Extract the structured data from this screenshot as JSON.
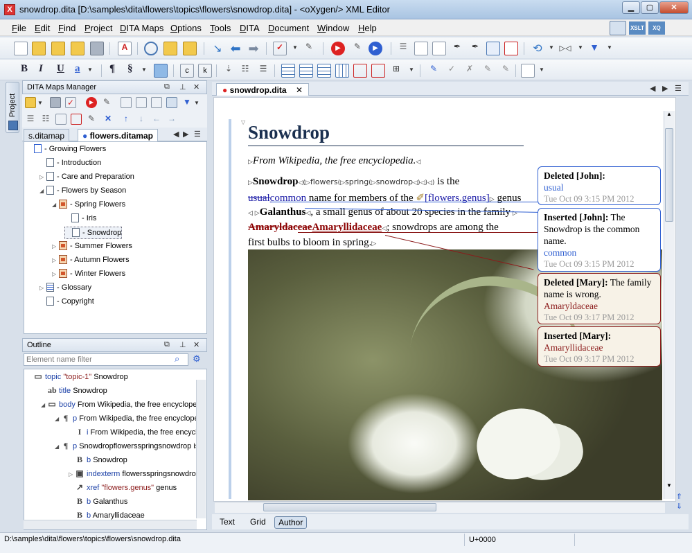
{
  "window": {
    "title": "snowdrop.dita [D:\\samples\\dita\\flowers\\topics\\flowers\\snowdrop.dita] - <oXygen/> XML Editor"
  },
  "menu": [
    "File",
    "Edit",
    "Find",
    "Project",
    "DITA Maps",
    "Options",
    "Tools",
    "DITA",
    "Document",
    "Window",
    "Help"
  ],
  "side_tab": "Project",
  "maps_manager": {
    "title": "DITA Maps Manager",
    "tabs": [
      "s.ditamap",
      "flowers.ditamap"
    ],
    "tree": [
      {
        "label": "Growing Flowers",
        "depth": 0,
        "type": "root"
      },
      {
        "label": "Introduction",
        "depth": 1,
        "type": "doc"
      },
      {
        "label": "Care and Preparation",
        "depth": 1,
        "type": "doc",
        "toggle": "▷"
      },
      {
        "label": "Flowers by Season",
        "depth": 1,
        "type": "doc",
        "toggle": "◢"
      },
      {
        "label": "Spring Flowers",
        "depth": 2,
        "type": "map",
        "toggle": "◢"
      },
      {
        "label": "Iris",
        "depth": 3,
        "type": "doc"
      },
      {
        "label": "Snowdrop",
        "depth": 3,
        "type": "doc",
        "selected": true
      },
      {
        "label": "Summer Flowers",
        "depth": 2,
        "type": "map",
        "toggle": "▷"
      },
      {
        "label": "Autumn Flowers",
        "depth": 2,
        "type": "map",
        "toggle": "▷"
      },
      {
        "label": "Winter Flowers",
        "depth": 2,
        "type": "map",
        "toggle": "▷"
      },
      {
        "label": "Glossary",
        "depth": 1,
        "type": "list",
        "toggle": "▷"
      },
      {
        "label": "Copyright",
        "depth": 1,
        "type": "doc"
      }
    ]
  },
  "outline": {
    "title": "Outline",
    "filter_placeholder": "Element name filter",
    "rows": [
      {
        "indent": 0,
        "icon": "▭",
        "tag": "topic",
        "attr": "\"topic-1\"",
        "text": "Snowdrop"
      },
      {
        "indent": 1,
        "icon": "ab",
        "tag": "title",
        "attr": "",
        "text": "Snowdrop"
      },
      {
        "indent": 1,
        "icon": "▭",
        "tag": "body",
        "attr": "",
        "text": "From Wikipedia, the free encyclopec",
        "toggle": "◢"
      },
      {
        "indent": 2,
        "icon": "¶",
        "tag": "p",
        "attr": "",
        "text": "From Wikipedia, the free encyclope",
        "toggle": "◢"
      },
      {
        "indent": 3,
        "icon": "I",
        "tag": "i",
        "attr": "",
        "text": "From Wikipedia, the free encycl"
      },
      {
        "indent": 2,
        "icon": "¶",
        "tag": "p",
        "attr": "",
        "text": "Snowdropflowersspringsnowdrop is",
        "toggle": "◢"
      },
      {
        "indent": 3,
        "icon": "B",
        "tag": "b",
        "attr": "",
        "text": "Snowdrop"
      },
      {
        "indent": 3,
        "icon": "▣",
        "tag": "indexterm",
        "attr": "",
        "text": "flowersspringsnowdrop",
        "toggle": "▷"
      },
      {
        "indent": 3,
        "icon": "↗",
        "tag": "xref",
        "attr": "\"flowers.genus\"",
        "text": "genus"
      },
      {
        "indent": 3,
        "icon": "B",
        "tag": "b",
        "attr": "",
        "text": "Galanthus"
      },
      {
        "indent": 3,
        "icon": "B",
        "tag": "b",
        "attr": "",
        "text": "Amaryllidaceae"
      }
    ]
  },
  "editor": {
    "tab": "snowdrop.dita",
    "doc_title": "Snowdrop",
    "p1": "From Wikipedia, the free encyclopedia.",
    "p2": {
      "snowdrop": "Snowdrop",
      "idx1": "flowers",
      "idx2": "spring",
      "idx3": "snowdrop",
      "is_the": " is the",
      "del_word": "usual",
      "ins_word": "common",
      "rest1": " name for members of the ",
      "xref": "[flowers.genus]",
      "genus": " genus",
      "galanthus": "Galanthus",
      "rest2": ", a small genus of about 20 species in the family",
      "del_family": "Amaryldaceae",
      "ins_family": "Amaryllidaceae",
      "rest3": "; snowdrops are among the",
      "rest4": "first bulbs to bloom in spring."
    },
    "modes": [
      "Text",
      "Grid",
      "Author"
    ]
  },
  "changes": [
    {
      "head": "Deleted [John]:",
      "body": "",
      "value": "usual",
      "date": "Tue Oct 09 3:15 PM 2012",
      "style": "blue"
    },
    {
      "head": "Inserted [John]:",
      "body": "The Snowdrop is the common name.",
      "value": "common",
      "date": "Tue Oct 09 3:15 PM 2012",
      "style": "blue"
    },
    {
      "head": "Deleted [Mary]:",
      "body": "The family name is wrong.",
      "value": "Amaryldaceae",
      "date": "Tue Oct 09 3:17 PM 2012",
      "style": "red"
    },
    {
      "head": "Inserted [Mary]:",
      "body": "",
      "value": "Amaryllidaceae",
      "date": "Tue Oct 09 3:17 PM 2012",
      "style": "red"
    }
  ],
  "status": {
    "path": "D:\\samples\\dita\\flowers\\topics\\flowers\\snowdrop.dita",
    "char": "U+0000"
  },
  "colors": {
    "accent": "#2f5fd1",
    "tracked_red": "#8b1a1a",
    "title_blue": "#1a2f4f"
  }
}
